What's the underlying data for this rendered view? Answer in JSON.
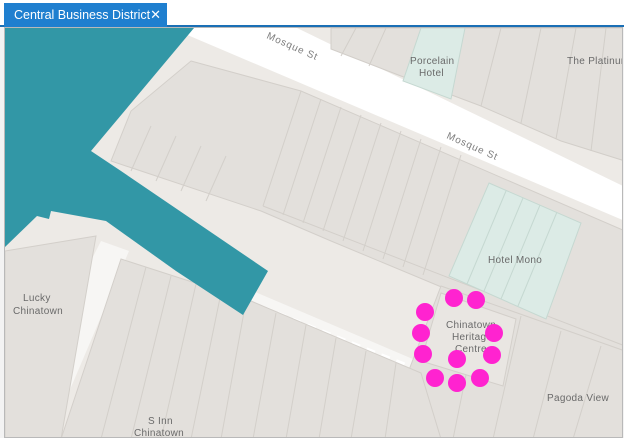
{
  "tab": {
    "title": "Central Business District",
    "icon": "map-icon",
    "close_glyph": "✕",
    "active_color": "#1f7fcf"
  },
  "map": {
    "background_color": "#edeae6",
    "building_color": "#e3e0dc",
    "road_color": "#ffffff",
    "water_color": "#3297a6",
    "highlight_building_color": "#dcebe6",
    "marker_color": "#ff23d0",
    "streets": [
      "Mosque St",
      "Mosque St"
    ],
    "place_labels": {
      "porcelain_hotel": [
        "Porcelain",
        "Hotel"
      ],
      "the_platinum": [
        "The Platinum"
      ],
      "hotel_mono": [
        "Hotel Mono"
      ],
      "lucky_chinatown": [
        "Lucky",
        "Chinatown"
      ],
      "chinatown_heritage_centre": [
        "Chinatown",
        "Heritage",
        "Centre"
      ],
      "pagoda_view": [
        "Pagoda View"
      ],
      "s_inn_chinatown": [
        "S Inn",
        "Chinatown"
      ]
    },
    "marker_count": 12
  }
}
